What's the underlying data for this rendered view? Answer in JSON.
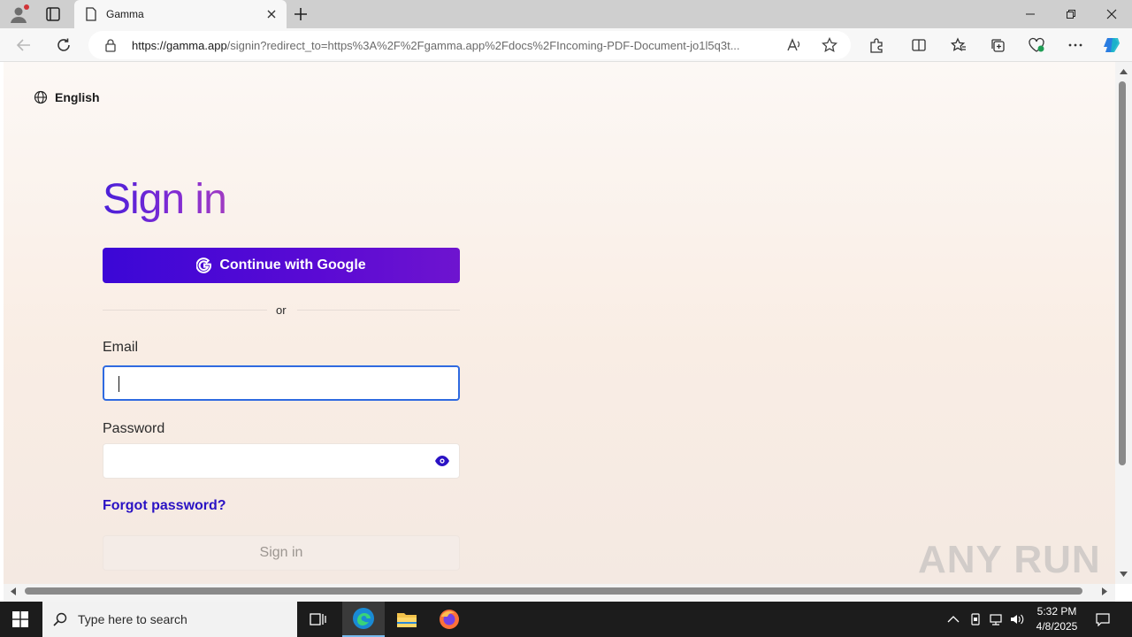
{
  "browser": {
    "tab_title": "Gamma",
    "url_host": "https://gamma.app",
    "url_path": "/signin?redirect_to=https%3A%2F%2Fgamma.app%2Fdocs%2FIncoming-PDF-Document-jo1l5q3t..."
  },
  "page": {
    "language": "English",
    "title": "Sign in",
    "google_button": "Continue with Google",
    "divider_text": "or",
    "email_label": "Email",
    "email_value": "",
    "password_label": "Password",
    "password_value": "",
    "forgot_link": "Forgot password?",
    "signin_button": "Sign in"
  },
  "watermark": "ANY RUN",
  "taskbar": {
    "search_placeholder": "Type here to search",
    "time": "5:32 PM",
    "date": "4/8/2025"
  },
  "colors": {
    "accent": "#3b07d6",
    "link": "#2a12c4",
    "focus_border": "#2f6ae0"
  }
}
